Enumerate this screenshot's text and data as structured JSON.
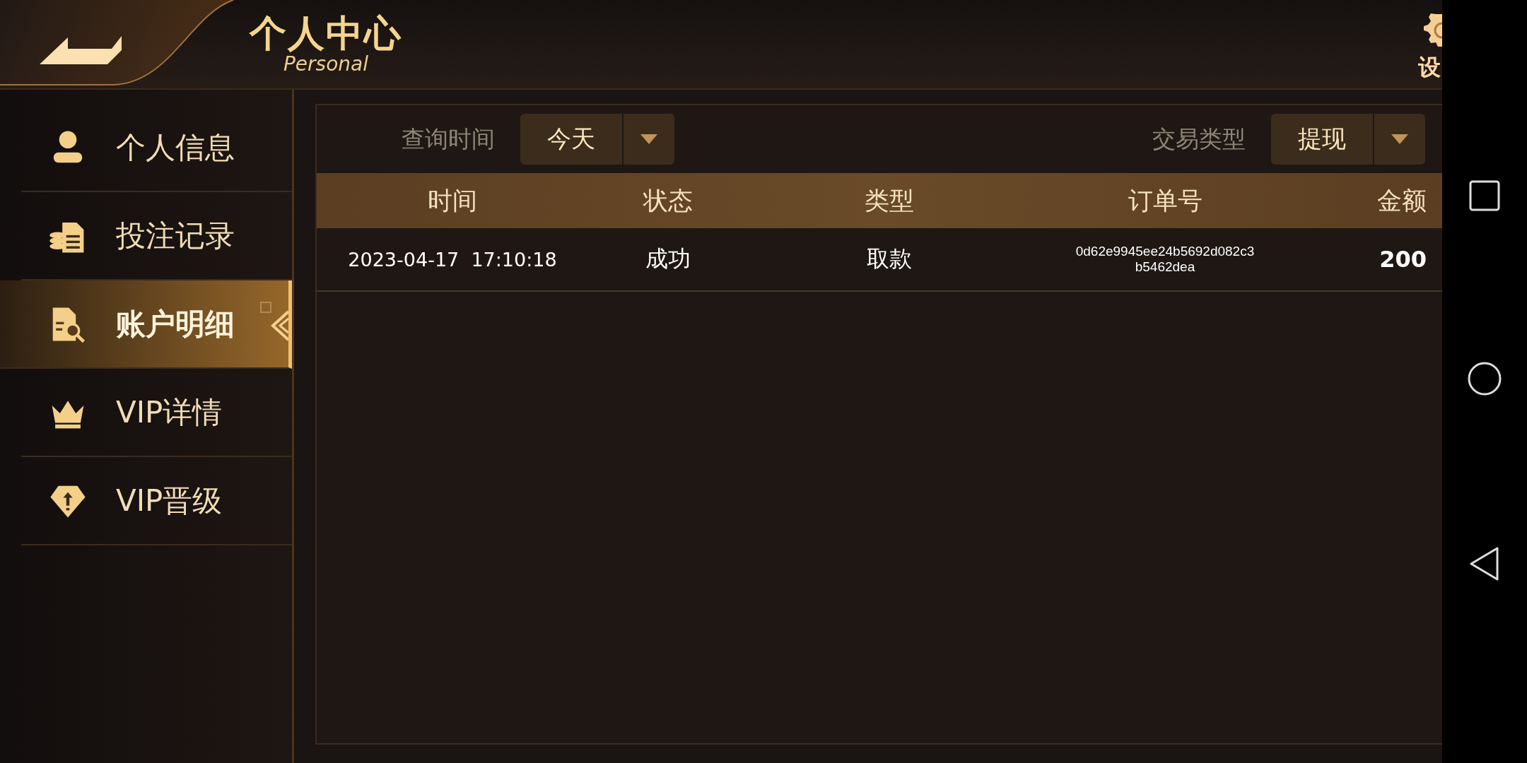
{
  "header": {
    "title": "个人中心",
    "subtitle": "Personal",
    "settings_label": "设"
  },
  "sidebar": {
    "items": [
      {
        "label": "个人信息",
        "selected": false
      },
      {
        "label": "投注记录",
        "selected": false
      },
      {
        "label": "账户明细",
        "selected": true
      },
      {
        "label": "VIP详情",
        "selected": false
      },
      {
        "label": "VIP晋级",
        "selected": false
      }
    ]
  },
  "filters": [
    {
      "label": "查询时间",
      "value": "今天"
    },
    {
      "label": "交易类型",
      "value": "提现"
    }
  ],
  "table": {
    "columns": [
      "时间",
      "状态",
      "类型",
      "订单号",
      "金额"
    ],
    "rows": [
      {
        "cells": [
          "2023-04-17  17:10:18",
          "成功",
          "取款",
          "0d62e9945ee24b5692d082c3b5462dea",
          "200"
        ]
      }
    ]
  }
}
